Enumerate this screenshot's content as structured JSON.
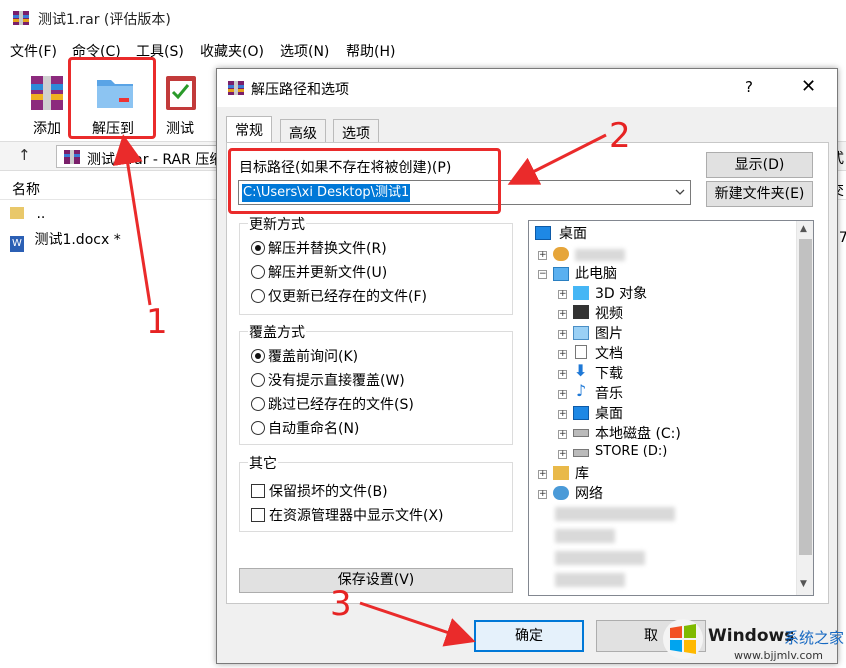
{
  "window": {
    "title": "测试1.rar (评估版本)",
    "menu": [
      "文件(F)",
      "命令(C)",
      "工具(S)",
      "收藏夹(O)",
      "选项(N)",
      "帮助(H)"
    ],
    "toolbar": {
      "add": "添加",
      "extract_to": "解压到",
      "test": "测试"
    },
    "address": "测试1.rar - RAR 压缩",
    "list_header": "名称",
    "rows": [
      "..",
      "测试1.docx *"
    ],
    "right_clip_top": "式",
    "right_clip_mid": "交",
    "right_clip_bottom": "37"
  },
  "dialog": {
    "title": "解压路径和选项",
    "help": "?",
    "close": "✕",
    "tabs": [
      "常规",
      "高级",
      "选项"
    ],
    "path_label": "目标路径(如果不存在将被创建)(P)",
    "path_value": "C:\\Users\\xi          Desktop\\测试1",
    "show_button": "显示(D)",
    "new_folder_button": "新建文件夹(E)",
    "update_mode": {
      "title": "更新方式",
      "options": [
        "解压并替换文件(R)",
        "解压并更新文件(U)",
        "仅更新已经存在的文件(F)"
      ],
      "selected": 0
    },
    "overwrite_mode": {
      "title": "覆盖方式",
      "options": [
        "覆盖前询问(K)",
        "没有提示直接覆盖(W)",
        "跳过已经存在的文件(S)",
        "自动重命名(N)"
      ],
      "selected": 0
    },
    "other": {
      "title": "其它",
      "options": [
        "保留损坏的文件(B)",
        "在资源管理器中显示文件(X)"
      ]
    },
    "save_settings": "保存设置(V)",
    "ok": "确定",
    "cancel_clip": "取",
    "tree": {
      "desktop": "桌面",
      "this_pc": "此电脑",
      "children": [
        "3D 对象",
        "视频",
        "图片",
        "文档",
        "下载",
        "音乐",
        "桌面",
        "本地磁盘 (C:)",
        "STORE (D:)"
      ],
      "library": "库",
      "network": "网络"
    }
  },
  "annotations": {
    "n1": "1",
    "n2": "2",
    "n3": "3"
  },
  "watermark": {
    "brand": "Windows",
    "cn": "系统之家",
    "url": "www.bjjmlv.com"
  },
  "colors": {
    "accent": "#0078d7",
    "annotation": "#ea2b2b"
  }
}
